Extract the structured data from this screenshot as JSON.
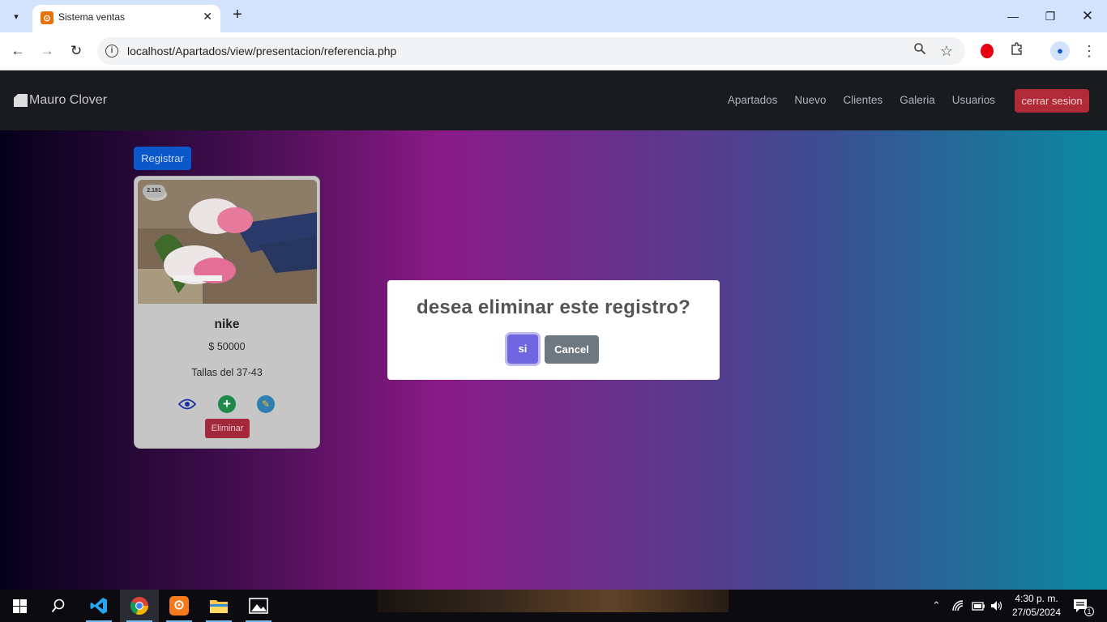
{
  "browser": {
    "tab_title": "Sistema ventas",
    "url": "localhost/Apartados/view/presentacion/referencia.php"
  },
  "navbar": {
    "brand": "Mauro Clover",
    "links": [
      "Apartados",
      "Nuevo",
      "Clientes",
      "Galeria",
      "Usuarios"
    ],
    "logout_label": "cerrar sesion"
  },
  "main": {
    "register_label": "Registrar",
    "card": {
      "badge": "2.181",
      "title": "nike",
      "price": "$ 50000",
      "sizes": "Tallas del 37-43",
      "delete_label": "Eliminar"
    }
  },
  "modal": {
    "title": "desea eliminar este registro?",
    "confirm_label": "si",
    "cancel_label": "Cancel"
  },
  "taskbar": {
    "time": "4:30 p. m.",
    "date": "27/05/2024",
    "notification_count": "1"
  },
  "colors": {
    "modal_confirm": "#7066e0",
    "modal_cancel": "#6e7881",
    "logout": "#b02a37",
    "register": "#0a58ca"
  }
}
